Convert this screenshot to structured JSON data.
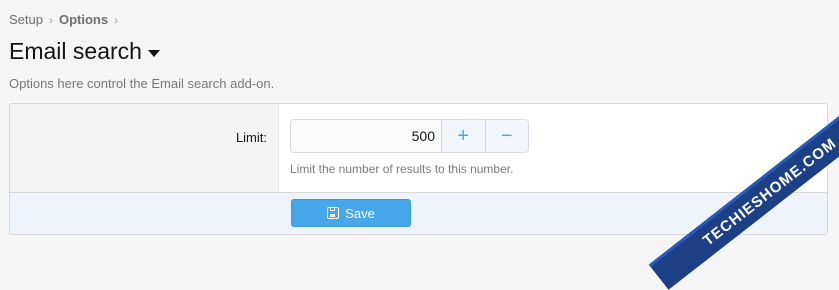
{
  "breadcrumb": {
    "items": [
      "Setup",
      "Options"
    ]
  },
  "header": {
    "title": "Email search",
    "description": "Options here control the Email search add-on."
  },
  "form": {
    "limit": {
      "label": "Limit:",
      "value": "500",
      "hint": "Limit the number of results to this number.",
      "increment_label": "+",
      "decrement_label": "−"
    },
    "save_label": "Save"
  },
  "watermark": {
    "text": "TECHIESHOME.COM"
  },
  "colors": {
    "accent": "#47a7eb",
    "watermark_bg": "#1c3f86"
  }
}
